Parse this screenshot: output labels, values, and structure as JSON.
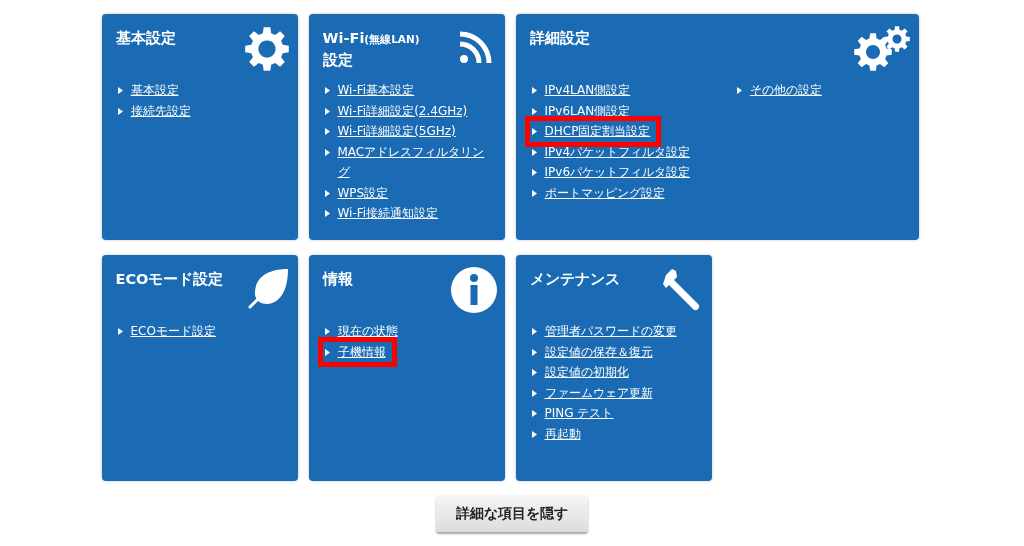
{
  "cards": [
    {
      "title": [
        {
          "text": "基本設定",
          "small": false
        }
      ],
      "wide": false,
      "columns": [
        [
          {
            "label": "基本設定",
            "highlighted": false
          },
          {
            "label": "接続先設定",
            "highlighted": false
          }
        ]
      ]
    },
    {
      "title": [
        {
          "text": "Wi-Fi",
          "small": false
        },
        {
          "text": "(無線LAN)",
          "small": true
        },
        {
          "text": "設定",
          "small": false
        }
      ],
      "wide": false,
      "columns": [
        [
          {
            "label": "Wi-Fi基本設定",
            "highlighted": false
          },
          {
            "label": "Wi-Fi詳細設定(2.4GHz)",
            "highlighted": false
          },
          {
            "label": "Wi-Fi詳細設定(5GHz)",
            "highlighted": false
          },
          {
            "label": "MACアドレスフィルタリング",
            "highlighted": false
          },
          {
            "label": "WPS設定",
            "highlighted": false
          },
          {
            "label": "Wi-Fi接続通知設定",
            "highlighted": false
          }
        ]
      ]
    },
    {
      "title": [
        {
          "text": "詳細設定",
          "small": false
        }
      ],
      "wide": true,
      "columns": [
        [
          {
            "label": "IPv4LAN側設定",
            "highlighted": false
          },
          {
            "label": "IPv6LAN側設定",
            "highlighted": false
          },
          {
            "label": "DHCP固定割当設定",
            "highlighted": true
          },
          {
            "label": "IPv4パケットフィルタ設定",
            "highlighted": false
          },
          {
            "label": "IPv6パケットフィルタ設定",
            "highlighted": false
          },
          {
            "label": "ポートマッピング設定",
            "highlighted": false
          }
        ],
        [
          {
            "label": "その他の設定",
            "highlighted": false
          }
        ]
      ]
    },
    {
      "title": [
        {
          "text": "ECOモード設定",
          "small": false
        }
      ],
      "wide": false,
      "columns": [
        [
          {
            "label": "ECOモード設定",
            "highlighted": false
          }
        ]
      ]
    },
    {
      "title": [
        {
          "text": "情報",
          "small": false
        }
      ],
      "wide": false,
      "columns": [
        [
          {
            "label": "現在の状態",
            "highlighted": false
          },
          {
            "label": "子機情報",
            "highlighted": true
          }
        ]
      ]
    },
    {
      "title": [
        {
          "text": "メンテナンス",
          "small": false
        }
      ],
      "wide": false,
      "columns": [
        [
          {
            "label": "管理者パスワードの変更",
            "highlighted": false
          },
          {
            "label": "設定値の保存＆復元",
            "highlighted": false
          },
          {
            "label": "設定値の初期化",
            "highlighted": false
          },
          {
            "label": "ファームウェア更新",
            "highlighted": false
          },
          {
            "label": "PING テスト",
            "highlighted": false
          },
          {
            "label": "再起動",
            "highlighted": false
          }
        ]
      ]
    }
  ],
  "button": {
    "label": "詳細な項目を隠す"
  }
}
